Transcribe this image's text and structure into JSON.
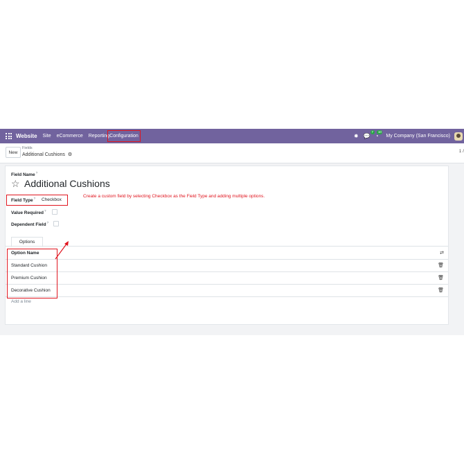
{
  "navbar": {
    "brand": "Website",
    "menu": [
      "Site",
      "eCommerce",
      "Reporting"
    ],
    "active_menu": "Configuration",
    "chat_count": "7",
    "activity_count": "10",
    "company": "My Company (San Francisco)"
  },
  "control_panel": {
    "new_label": "New",
    "breadcrumb_parent": "Fields",
    "breadcrumb_current": "Additional Cushions",
    "pager": "1 /"
  },
  "form": {
    "field_name_label": "Field Name",
    "field_name_value": "Additional Cushions",
    "field_type_label": "Field Type",
    "field_type_value": "Checkbox",
    "value_required_label": "Value Required",
    "dependent_field_label": "Dependent Field",
    "help_mark": "?",
    "annotation": "Create a custom field by selecting Checkbox as the Field Type and adding multiple options."
  },
  "options_tab": {
    "tab_label": "Options",
    "column_header": "Option Name",
    "rows": [
      "Standard Cushion",
      "Premium Cushion",
      "Decorative Cushion"
    ],
    "add_line": "Add a line"
  },
  "colors": {
    "navbar": "#71639e",
    "highlight": "#e0141e"
  },
  "icons": [
    "apps-grid-icon",
    "bug-icon",
    "chat-icon",
    "activity-clock-icon",
    "gear-icon",
    "star-icon",
    "column-settings-icon",
    "trash-icon"
  ]
}
